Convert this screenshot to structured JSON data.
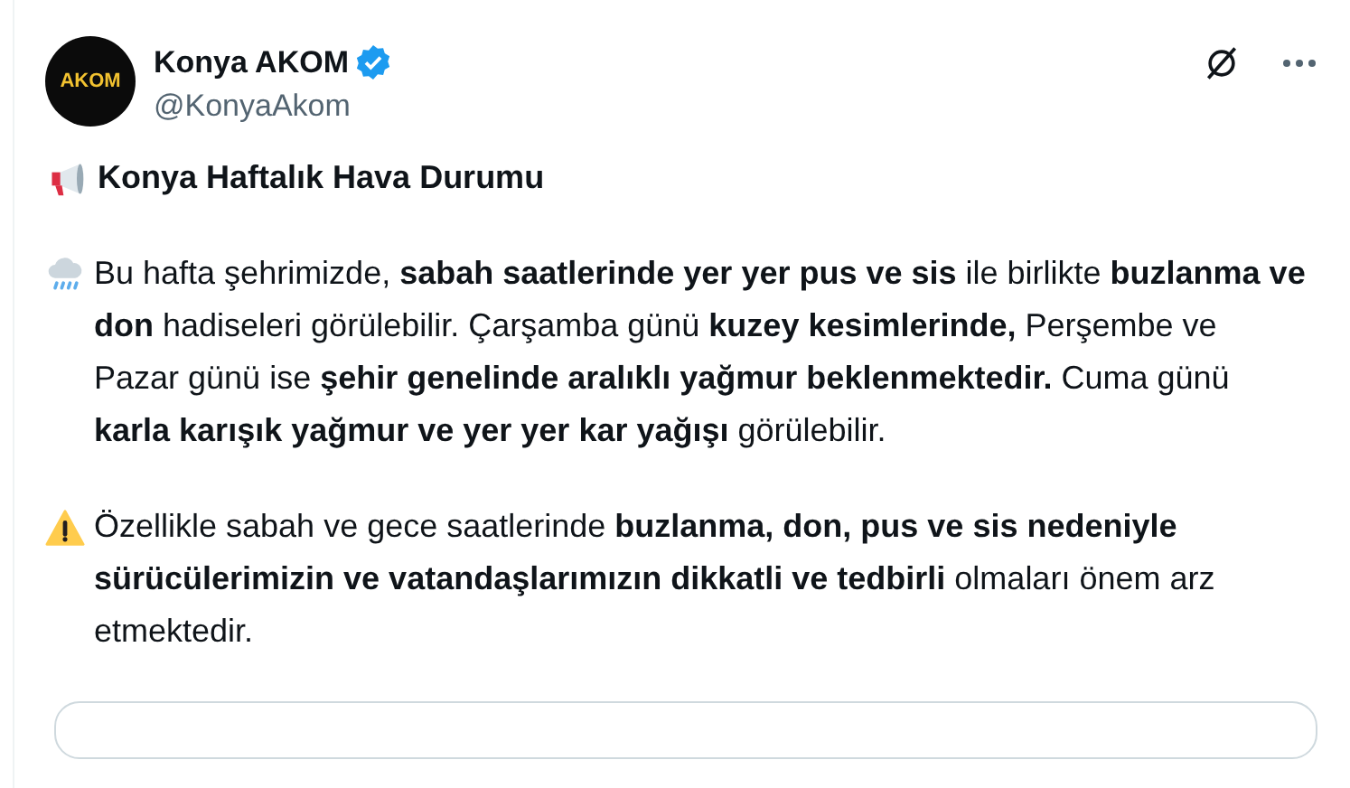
{
  "author": {
    "name": "Konya AKOM",
    "handle": "@KonyaAkom",
    "verified": true,
    "avatar_text": "AKOM"
  },
  "paragraphs": [
    {
      "kind": "heading",
      "text": "Konya Haftalık Hava Durumu"
    },
    {
      "kind": "body",
      "text": "Bu hafta şehrimizde, **sabah saatlerinde yer yer pus ve sis** ile birlikte **buzlanma ve don** hadiseleri görülebilir. Çarşamba günü **kuzey kesimlerinde,** Perşembe ve Pazar günü ise **şehir genelinde aralıklı yağmur beklenmektedir.** Cuma günü **karla karışık yağmur ve yer yer kar yağışı** görülebilir."
    },
    {
      "kind": "body",
      "text": "Özellikle sabah ve gece saatlerinde **buzlanma, don, pus ve sis nedeniyle sürücülerimizin ve vatandaşlarımızın dikkatli ve tedbirli** olmaları önem arz etmektedir."
    }
  ]
}
